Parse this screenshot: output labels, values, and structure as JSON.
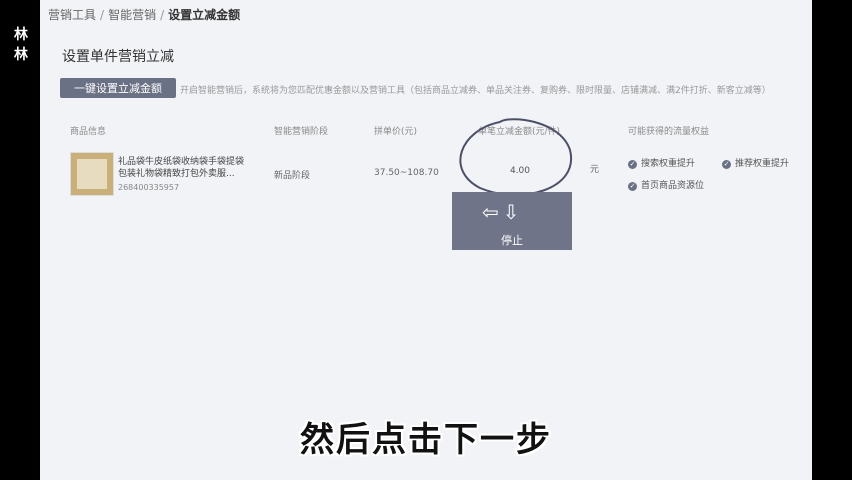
{
  "watermark": "林林",
  "breadcrumb": {
    "item1": "营销工具",
    "item2": "智能营销",
    "current": "设置立减金额",
    "sep": "/"
  },
  "section_title": "设置单件营销立减",
  "primary_button": "一键设置立减金额",
  "hint": "开启智能营销后，系统将为您匹配优惠金额以及营销工具（包括商品立减券、单品关注券、复购券、限时限量、店铺满减、满2件打折、新客立减等）",
  "table": {
    "headers": {
      "product": "商品信息",
      "stage": "智能营销阶段",
      "price": "拼单价(元)",
      "amount": "单笔立减金额(元/件)",
      "benefits": "可能获得的流量权益"
    },
    "row": {
      "name": "礼品袋牛皮纸袋收纳袋手袋提袋包装礼物袋精致打包外卖服...",
      "id": "268400335957",
      "stage": "新品阶段",
      "price": "37.50~108.70",
      "amount": "4.00",
      "unit": "元",
      "benefits": [
        "搜索权重提升",
        "推荐权重提升",
        "首页商品资源位"
      ]
    }
  },
  "overlay": {
    "stop_label": "停止",
    "icons": [
      "arrow-left-icon",
      "arrow-down-icon"
    ]
  },
  "subtitle": "然后点击下一步",
  "colors": {
    "accent": "#6b7184",
    "page_bg": "#f2f3f7"
  }
}
